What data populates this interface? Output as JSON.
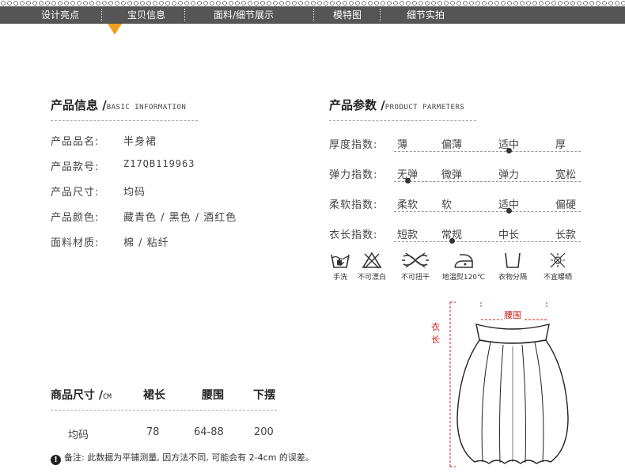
{
  "nav": {
    "items": [
      "设计亮点",
      "宝贝信息",
      "面料/细节展示",
      "模特图",
      "细节实拍"
    ]
  },
  "info": {
    "title": "产品信息 /",
    "title_en": "BASIC INFORMATION",
    "rows": [
      {
        "label": "产品品名:",
        "value": "半身裙"
      },
      {
        "label": "产品款号:",
        "value": "Z17QB119963"
      },
      {
        "label": "产品尺寸:",
        "value": "均码"
      },
      {
        "label": "产品颜色:",
        "value": "藏青色 / 黑色 / 酒红色"
      },
      {
        "label": "面料材质:",
        "value": "棉 / 粘纤"
      }
    ]
  },
  "params": {
    "title": "产品参数 /",
    "title_en": "PRODUCT PARMETERS",
    "rows": [
      {
        "label": "厚度指数:",
        "options": [
          "薄",
          "偏薄",
          "适中",
          "厚"
        ],
        "selected": 2
      },
      {
        "label": "弹力指数:",
        "options": [
          "无弹",
          "微弹",
          "弹力",
          "宽松"
        ],
        "selected": 0
      },
      {
        "label": "柔软指数:",
        "options": [
          "柔软",
          "软",
          "适中",
          "偏硬"
        ],
        "selected": 2
      },
      {
        "label": "衣长指数:",
        "options": [
          "短款",
          "常规",
          "中长",
          "长款"
        ],
        "selected": 1
      }
    ]
  },
  "care": {
    "items": [
      {
        "icon": "hand-wash-icon",
        "label": "手洗"
      },
      {
        "icon": "no-bleach-icon",
        "label": "不可漂白"
      },
      {
        "icon": "no-wring-icon",
        "label": "不可扭干"
      },
      {
        "icon": "low-iron-icon",
        "label": "地温熨120℃"
      },
      {
        "icon": "separate-wash-icon",
        "label": "衣物分隔"
      },
      {
        "icon": "no-sun-dry-icon",
        "label": "不宜曝晒"
      }
    ]
  },
  "size_table": {
    "title": "商品尺寸 /",
    "unit": "CM",
    "headers": [
      "裙长",
      "腰围",
      "下摆"
    ],
    "rows": [
      {
        "size": "均码",
        "values": [
          "78",
          "64-88",
          "200"
        ]
      }
    ]
  },
  "note": {
    "icon": "exclamation-icon",
    "bang": "!",
    "text": "备注: 此数据为平铺测量, 因方法不同, 可能会有 2-4cm 的误差。"
  },
  "diagram": {
    "waist_label": "腰围",
    "length_label": "衣长",
    "accent_color": "#d0201c"
  }
}
